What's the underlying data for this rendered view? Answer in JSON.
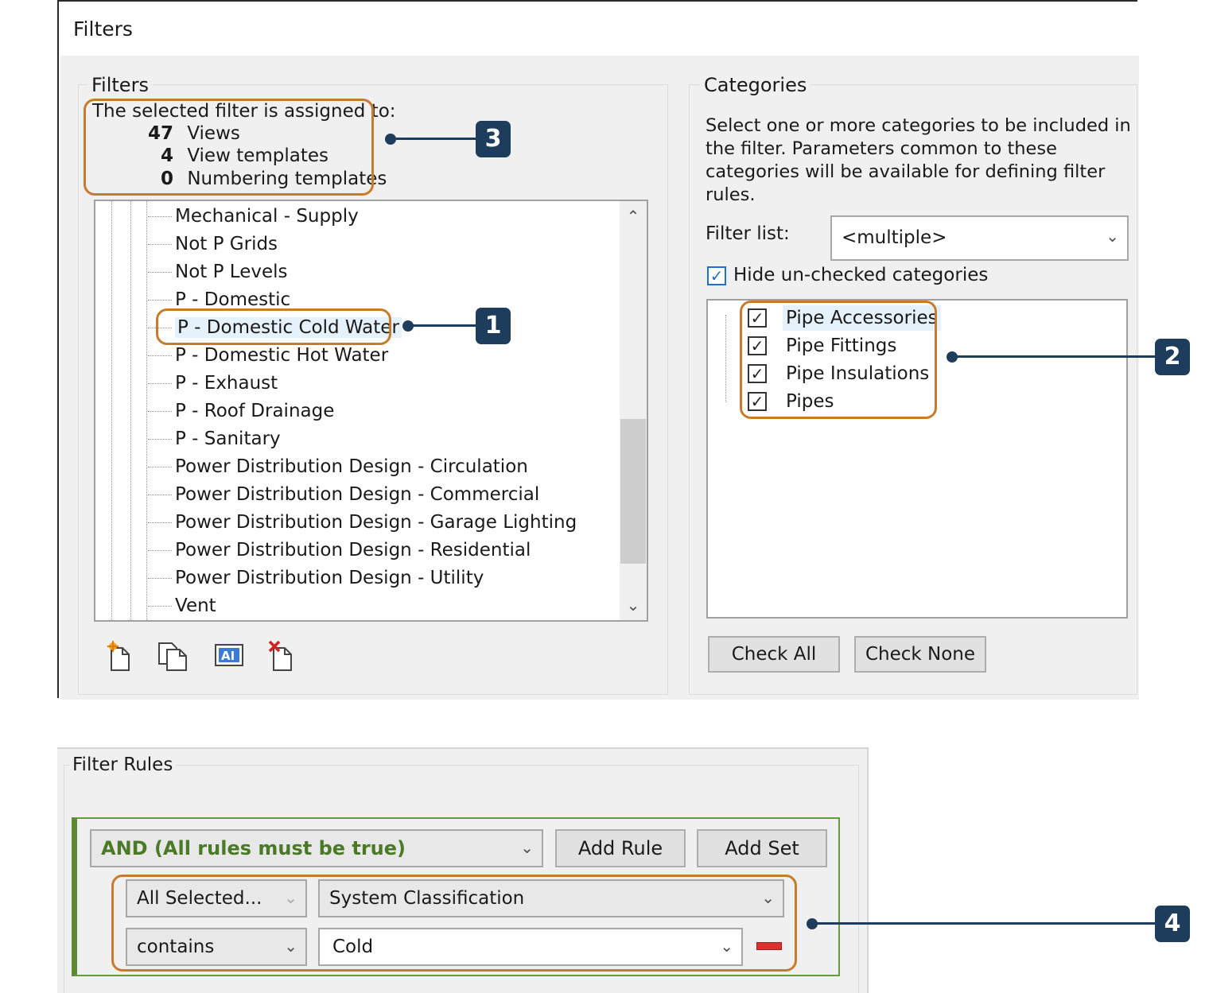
{
  "window": {
    "title": "Filters"
  },
  "filters_group": {
    "label": "Filters",
    "assigned": {
      "heading": "The selected filter is assigned to:",
      "rows": [
        {
          "count": "47",
          "label": "Views"
        },
        {
          "count": "4",
          "label": "View templates"
        },
        {
          "count": "0",
          "label": "Numbering templates"
        }
      ]
    },
    "tree_items": [
      "Mechanical - Supply",
      "Not P Grids",
      "Not P Levels",
      "P - Domestic",
      "P - Domestic Cold Water",
      "P - Domestic Hot Water",
      "P - Exhaust",
      "P - Roof Drainage",
      "P - Sanitary",
      "Power Distribution Design - Circulation",
      "Power Distribution Design - Commercial",
      "Power Distribution Design - Garage Lighting",
      "Power Distribution Design - Residential",
      "Power Distribution Design - Utility",
      "Vent"
    ],
    "selected_item": "P - Domestic Cold Water",
    "toolbar_icons": [
      "new-filter-icon",
      "duplicate-filter-icon",
      "rename-filter-icon",
      "delete-filter-icon"
    ]
  },
  "categories_group": {
    "label": "Categories",
    "description": "Select one or more categories to be included in the filter.  Parameters common to these categories will be available for defining filter rules.",
    "filter_list_label": "Filter list:",
    "filter_list_value": "<multiple>",
    "hide_unchecked_label": "Hide un-checked categories",
    "hide_unchecked_checked": true,
    "items": [
      {
        "label": "Pipe Accessories",
        "checked": true
      },
      {
        "label": "Pipe Fittings",
        "checked": true
      },
      {
        "label": "Pipe Insulations",
        "checked": true
      },
      {
        "label": "Pipes",
        "checked": true
      }
    ],
    "check_all_label": "Check All",
    "check_none_label": "Check None"
  },
  "filter_rules": {
    "label": "Filter Rules",
    "logic_value": "AND (All rules must be true)",
    "add_rule_label": "Add Rule",
    "add_set_label": "Add Set",
    "rule": {
      "category_value": "All Selected...",
      "parameter_value": "System Classification",
      "operator_value": "contains",
      "value": "Cold"
    }
  },
  "callouts": [
    "1",
    "2",
    "3",
    "4"
  ],
  "colors": {
    "callout_border": "#c97b2c",
    "badge": "#1e3d5c",
    "rule_set_border": "#6a9b3f",
    "logic_text": "#4b7a26",
    "remove_rule": "#d9322e"
  }
}
